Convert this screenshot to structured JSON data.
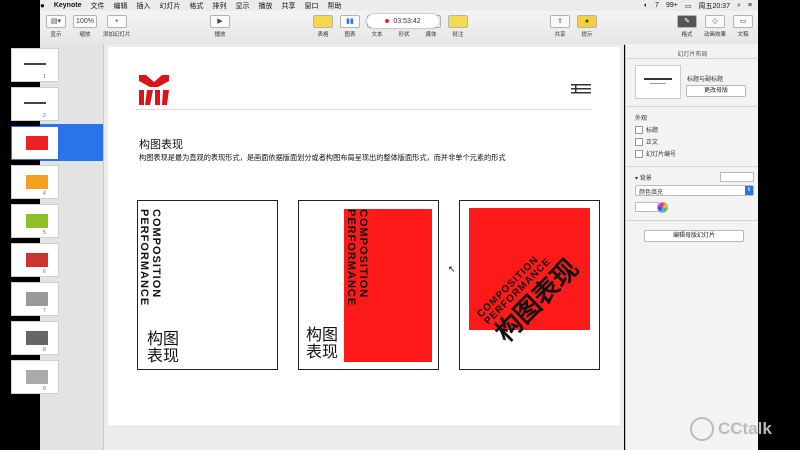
{
  "menubar": {
    "app": "Keynote",
    "items": [
      "文件",
      "编辑",
      "插入",
      "幻灯片",
      "格式",
      "排列",
      "显示",
      "播放",
      "共享",
      "窗口",
      "帮助"
    ],
    "status": [
      "7",
      "99+",
      "周五20:37"
    ]
  },
  "toolbar": {
    "view": "显示",
    "zoom": "100%",
    "zoom_label": "缩放",
    "add_slide": "添加幻灯片",
    "play": "播放",
    "table": "表格",
    "chart": "图表",
    "text": "文本",
    "shape": "形状",
    "media": "媒体",
    "comment": "批注",
    "share": "共享",
    "tips": "提示",
    "format": "格式",
    "animate": "动画效果",
    "document": "文稿",
    "recording_time": "03:53:42"
  },
  "navigator": {
    "slides": [
      "1",
      "2",
      "3",
      "4",
      "5",
      "6",
      "7",
      "8",
      "9"
    ],
    "selected": "3"
  },
  "slide": {
    "title": "构图表现",
    "desc": "构图表现是最为直观的表现形式，是画面依据版面划分或者构图布局呈现出的整体版面形式，而并非单个元素的形式",
    "vertical_en_1": "COMPOSITION",
    "vertical_en_2": "PERFORMANCE",
    "cn_line1": "构图",
    "cn_line2": "表现",
    "diag_cn": "构图表现",
    "accent": "#ff1a1a"
  },
  "inspector": {
    "header": "幻灯片布局",
    "layout_name": "标题与副标题",
    "change_master": "更改母版",
    "appearance": "外观",
    "cb_title": "标题",
    "cb_body": "正文",
    "cb_slide_number": "幻灯片编号",
    "background": "背景",
    "fill": "颜色填充",
    "edit_master": "编辑母版幻灯片"
  },
  "watermark": "CCtalk"
}
